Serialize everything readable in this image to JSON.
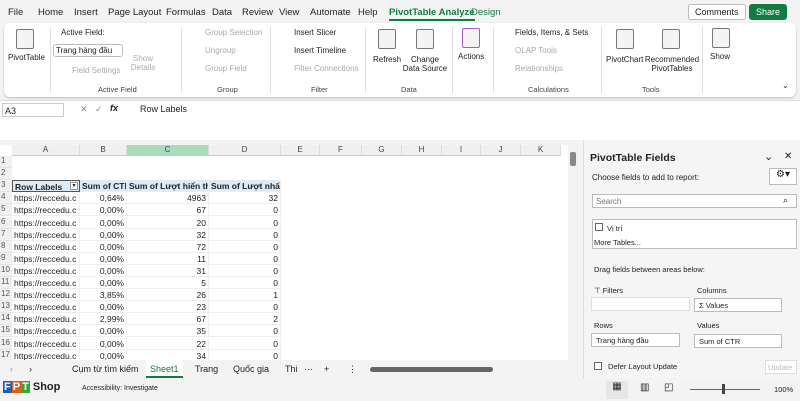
{
  "tabs": [
    "File",
    "Home",
    "Insert",
    "Page Layout",
    "Formulas",
    "Data",
    "Review",
    "View",
    "Automate",
    "Help",
    "PivotTable Analyze",
    "Design"
  ],
  "top_buttons": {
    "comments": "Comments",
    "share": "Share"
  },
  "ribbon": {
    "pivottable": "PivotTable",
    "active_field_label": "Active Field:",
    "active_field_value": "Trang hàng đầu",
    "field_settings": "Field Settings",
    "show_details": "Show Details",
    "group_active_field": "Active Field",
    "group_selection": "Group Selection",
    "ungroup": "Ungroup",
    "group_field": "Group Field",
    "group_group": "Group",
    "insert_slicer": "Insert Slicer",
    "insert_timeline": "Insert Timeline",
    "filter_connections": "Filter Connections",
    "group_filter": "Filter",
    "refresh": "Refresh",
    "change_data_source": "Change Data Source",
    "group_data": "Data",
    "actions": "Actions",
    "fields_items_sets": "Fields, Items, & Sets",
    "olap_tools": "OLAP Tools",
    "relationships": "Relationships",
    "group_calculations": "Calculations",
    "pivotchart": "PivotChart",
    "recommended": "Recommended PivotTables",
    "group_tools": "Tools",
    "show": "Show"
  },
  "formula_bar": {
    "name_box": "A3",
    "fx": "fx",
    "content": "Row Labels"
  },
  "columns": [
    "A",
    "B",
    "C",
    "D",
    "E",
    "F",
    "G",
    "H",
    "I",
    "J",
    "K"
  ],
  "table": {
    "headers": [
      "Row Labels",
      "Sum of CTR",
      "Sum of Lượt hiển thị",
      "Sum of Lượt nhấp"
    ],
    "rows": [
      [
        "https://reccedu.c",
        "0,64%",
        "4963",
        "32"
      ],
      [
        "https://reccedu.c",
        "0,00%",
        "67",
        "0"
      ],
      [
        "https://reccedu.c",
        "0,00%",
        "20",
        "0"
      ],
      [
        "https://reccedu.c",
        "0,00%",
        "32",
        "0"
      ],
      [
        "https://reccedu.c",
        "0,00%",
        "72",
        "0"
      ],
      [
        "https://reccedu.c",
        "0,00%",
        "11",
        "0"
      ],
      [
        "https://reccedu.c",
        "0,00%",
        "31",
        "0"
      ],
      [
        "https://reccedu.c",
        "0,00%",
        "5",
        "0"
      ],
      [
        "https://reccedu.c",
        "3,85%",
        "26",
        "1"
      ],
      [
        "https://reccedu.c",
        "0,00%",
        "23",
        "0"
      ],
      [
        "https://reccedu.c",
        "2,99%",
        "67",
        "2"
      ],
      [
        "https://reccedu.c",
        "0,00%",
        "35",
        "0"
      ],
      [
        "https://reccedu.c",
        "0,00%",
        "22",
        "0"
      ],
      [
        "https://reccedu.c",
        "0,00%",
        "34",
        "0"
      ]
    ]
  },
  "pane": {
    "title": "PivotTable Fields",
    "choose": "Choose fields to add to report:",
    "search_placeholder": "Search",
    "field": "Vị trí",
    "more_tables": "More Tables...",
    "drag": "Drag fields between areas below:",
    "filters": "Filters",
    "columns": "Columns",
    "columns_value": "Σ Values",
    "rows": "Rows",
    "rows_value": "Trang hàng đầu",
    "values": "Values",
    "values_value": "Sum of CTR",
    "defer": "Defer Layout Update",
    "update": "Update"
  },
  "sheets": [
    "Cụm từ tìm kiếm",
    "Sheet1",
    "Trang",
    "Quốc gia",
    "Thi"
  ],
  "status": {
    "accessibility": "Accessibility: Investigate",
    "zoom": "100%",
    "logo": "FPT Shop.com.vn"
  },
  "accent": "#107c41"
}
